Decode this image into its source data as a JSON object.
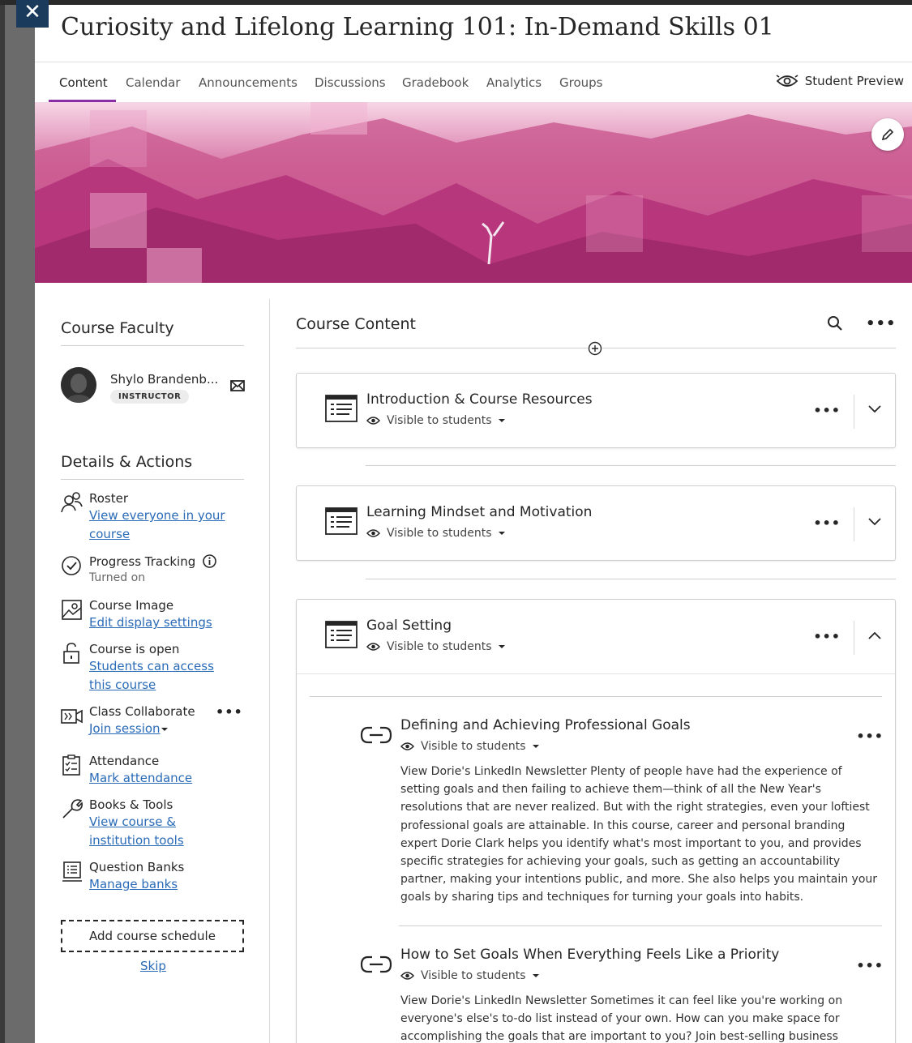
{
  "course": {
    "title": "Curiosity and Lifelong Learning 101: In-Demand Skills 01"
  },
  "nav": {
    "tabs": [
      "Content",
      "Calendar",
      "Announcements",
      "Discussions",
      "Gradebook",
      "Analytics",
      "Groups"
    ],
    "active_tab": "Content",
    "student_preview": "Student Preview"
  },
  "faculty": {
    "title": "Course Faculty",
    "name": "Shylo Brandenb...",
    "role": "INSTRUCTOR"
  },
  "details": {
    "title": "Details & Actions",
    "roster": {
      "label": "Roster",
      "link": "View everyone in your course"
    },
    "progress": {
      "label": "Progress Tracking",
      "status": "Turned on"
    },
    "image": {
      "label": "Course Image",
      "link": "Edit display settings"
    },
    "open": {
      "label": "Course is open",
      "link": "Students can access this course"
    },
    "collaborate": {
      "label": "Class Collaborate",
      "link": "Join session"
    },
    "attendance": {
      "label": "Attendance",
      "link": "Mark attendance"
    },
    "books": {
      "label": "Books & Tools",
      "link": "View course & institution tools"
    },
    "banks": {
      "label": "Question Banks",
      "link": "Manage banks"
    },
    "add_schedule": "Add course schedule",
    "skip": "Skip"
  },
  "content": {
    "title": "Course Content",
    "visibility": "Visible to students",
    "folders": [
      {
        "title": "Introduction & Course Resources",
        "expanded": false
      },
      {
        "title": "Learning Mindset and Motivation",
        "expanded": false
      },
      {
        "title": "Goal Setting",
        "expanded": true
      }
    ],
    "items": [
      {
        "title": "Defining and Achieving Professional Goals",
        "description": "View Dorie's LinkedIn Newsletter Plenty of people have had the experience of setting goals and then failing to achieve them—think of all the New Year's resolutions that are never realized. But with the right strategies, even your loftiest professional goals are attainable. In this course, career and personal branding expert Dorie Clark helps you identify what's most important to you, and provides specific strategies for achieving your goals, such as getting an accountability partner, making your intentions public, and more. She also helps you maintain your goals by sharing tips and techniques for turning your goals into habits."
      },
      {
        "title": "How to Set Goals When Everything Feels Like a Priority",
        "description": "View Dorie's LinkedIn Newsletter Sometimes it can feel like you're working on everyone's else's to-do list instead of your own. How can you make space for accomplishing the goals that are important to you? Join best-selling business"
      }
    ]
  },
  "colors": {
    "accent": "#8a2ea8",
    "link": "#2a6bb8",
    "banner": "#c2417f"
  }
}
